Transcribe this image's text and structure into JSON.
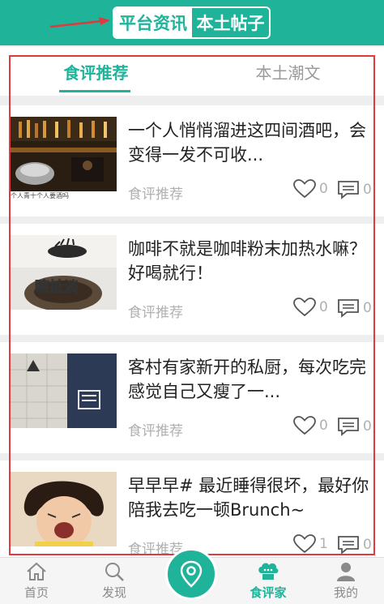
{
  "header": {
    "tab_platform": "平台资讯",
    "tab_local": "本土帖子",
    "accent": "#1fb39a"
  },
  "tabs": [
    {
      "label": "食评推荐",
      "active": true
    },
    {
      "label": "本土潮文",
      "active": false
    }
  ],
  "posts": [
    {
      "title": "一个人悄悄溜进这四间酒吧，会变得一发不可收...",
      "category": "食评推荐",
      "likes": "0",
      "comments": "0",
      "thumb_caption": "个人青十个人要酒吗"
    },
    {
      "title": "咖啡不就是咖啡粉末加热水嘛？好喝就行！",
      "category": "食评推荐",
      "likes": "0",
      "comments": "0",
      "thumb_text": "瞎扯淡"
    },
    {
      "title": "客村有家新开的私厨，每次吃完感觉自己又瘦了一...",
      "category": "食评推荐",
      "likes": "0",
      "comments": "0"
    },
    {
      "title": "早早早# 最近睡得很坏，最好你陪我去吃一顿Brunch~",
      "category": "食评推荐",
      "likes": "1",
      "comments": "0"
    }
  ],
  "nav": [
    {
      "label": "首页",
      "icon": "home-icon",
      "active": false
    },
    {
      "label": "发现",
      "icon": "search-icon",
      "active": false
    },
    {
      "label": "食评家",
      "icon": "chef-hat-icon",
      "active": true
    },
    {
      "label": "我的",
      "icon": "user-icon",
      "active": false
    }
  ],
  "center_button": {
    "icon": "location-pin-icon"
  }
}
